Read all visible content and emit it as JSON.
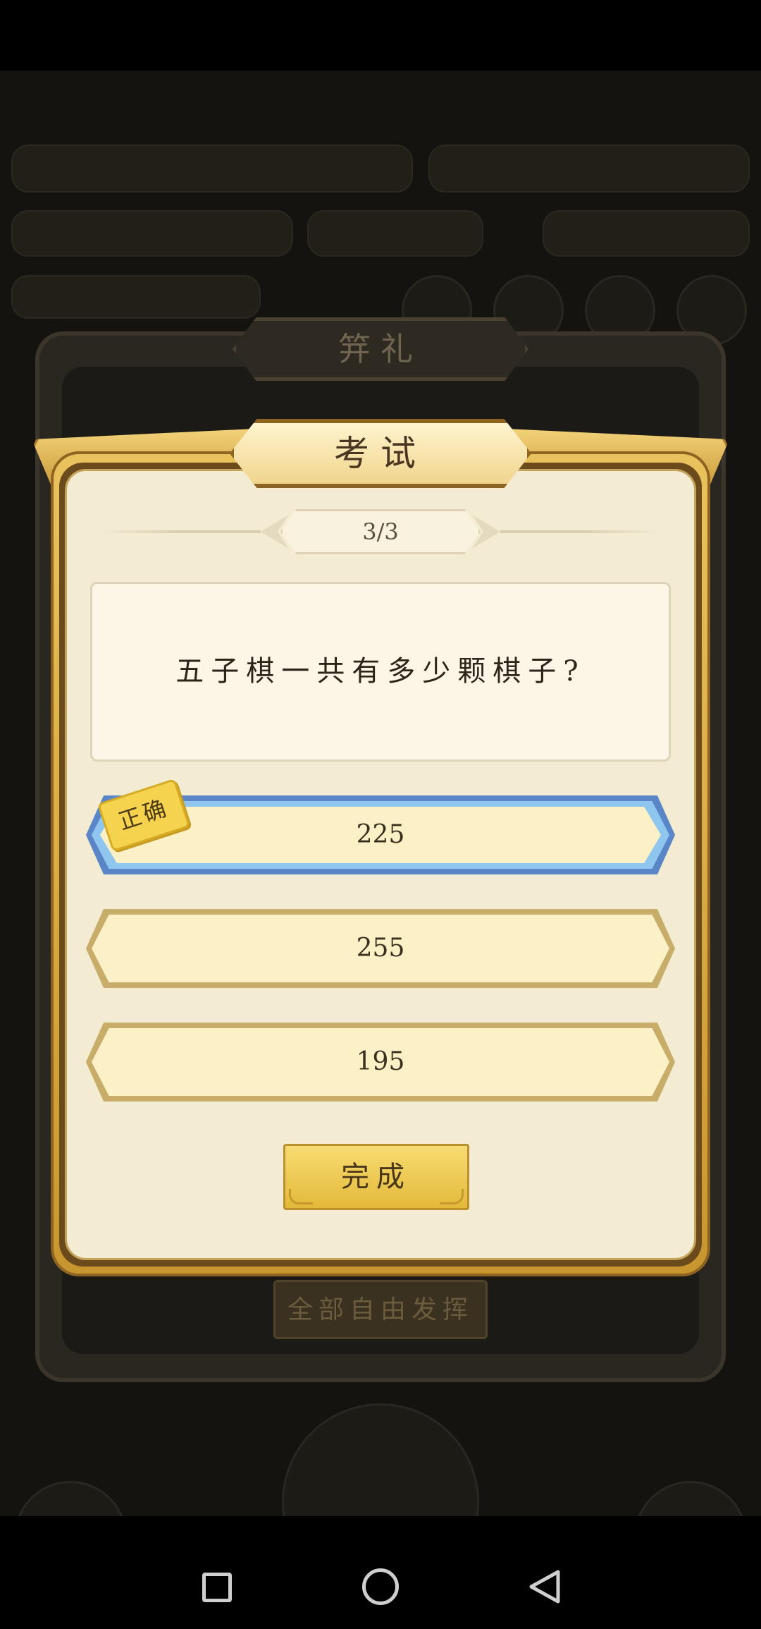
{
  "dialog": {
    "title": "考试",
    "progress": "3/3",
    "question": "五子棋一共有多少颗棋子?",
    "options": [
      {
        "label": "225",
        "state": "correct"
      },
      {
        "label": "255",
        "state": "normal"
      },
      {
        "label": "195",
        "state": "normal"
      }
    ],
    "correct_tag": "正确",
    "done_button": "完成"
  },
  "background": {
    "panel_title": "笄礼",
    "panel_button": "全部自由发挥"
  },
  "colors": {
    "gold": "#e9c25e",
    "panel_bg": "#f3ecd3",
    "correct_border": "#5a86c8",
    "option_fill": "#fcf0c6"
  }
}
